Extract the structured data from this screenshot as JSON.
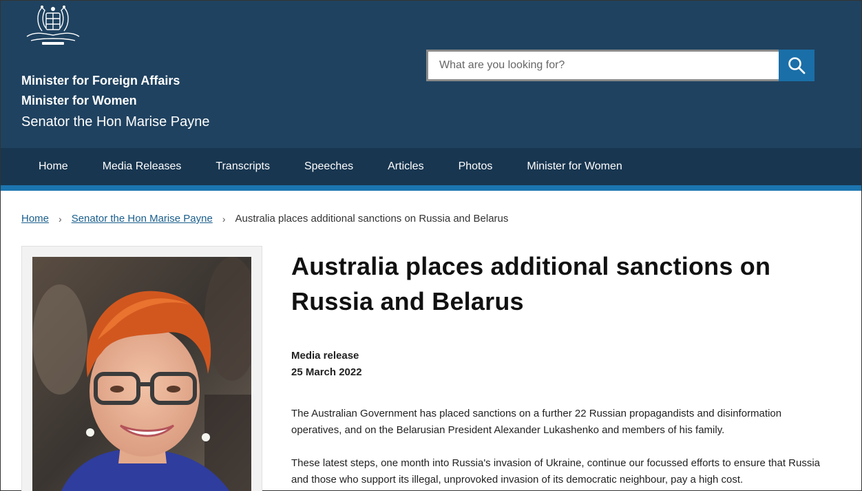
{
  "header": {
    "crest_icon": "australian-coat-of-arms",
    "title_line1": "Minister for Foreign Affairs",
    "title_line2": "Minister for Women",
    "title_line3": "Senator the Hon Marise Payne",
    "bg_color": "#1f4260"
  },
  "search": {
    "placeholder": "What are you looking for?",
    "value": "",
    "icon": "search-icon",
    "button_color": "#1a6fa8"
  },
  "nav": {
    "items": [
      {
        "label": "Home"
      },
      {
        "label": "Media Releases"
      },
      {
        "label": "Transcripts"
      },
      {
        "label": "Speeches"
      },
      {
        "label": "Articles"
      },
      {
        "label": "Photos"
      },
      {
        "label": "Minister for Women"
      }
    ]
  },
  "breadcrumb": {
    "home": "Home",
    "parent": "Senator the Hon Marise Payne",
    "current": "Australia places additional sanctions on Russia and Belarus"
  },
  "article": {
    "title": "Australia places additional sanctions on Russia and Belarus",
    "type": "Media release",
    "date": "25 March 2022",
    "paragraphs": [
      "The Australian Government has placed sanctions on a further 22 Russian propagandists and disinformation operatives, and on the Belarusian President Alexander Lukashenko and members of his family.",
      "These latest steps, one month into Russia's invasion of Ukraine, continue our focussed efforts to ensure that Russia and those who support its illegal, unprovoked invasion of its democratic neighbour, pay a high cost."
    ]
  }
}
